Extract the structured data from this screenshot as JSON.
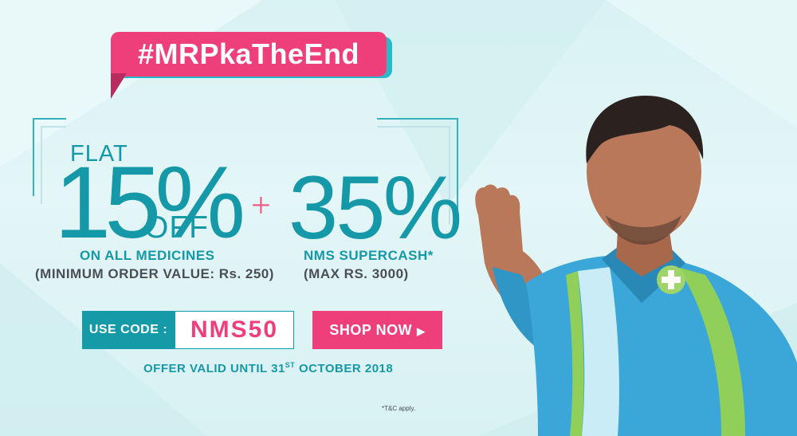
{
  "hashtag": "#MRPkaTheEnd",
  "offer1": {
    "flat": "FLAT",
    "percent": "15%",
    "off": "OFF",
    "asterisk": "*",
    "line1": "ON ALL MEDICINES",
    "line2": "(MINIMUM ORDER VALUE: Rs. 250)"
  },
  "plus": "+",
  "offer2": {
    "percent": "35%",
    "line1": "NMS SUPERCASH*",
    "line2": "(MAX RS. 3000)"
  },
  "code": {
    "label": "USE CODE :",
    "value": "NMS50"
  },
  "cta": {
    "label": "SHOP NOW",
    "arrow": "▶"
  },
  "validity": {
    "prefix": "OFFER VALID UNTIL 31",
    "sup": "ST",
    "suffix": " OCTOBER 2018"
  },
  "tnc": "*T&C apply.",
  "colors": {
    "pink": "#ef3f7b",
    "teal": "#159ba8",
    "background": "#dff4f5"
  }
}
